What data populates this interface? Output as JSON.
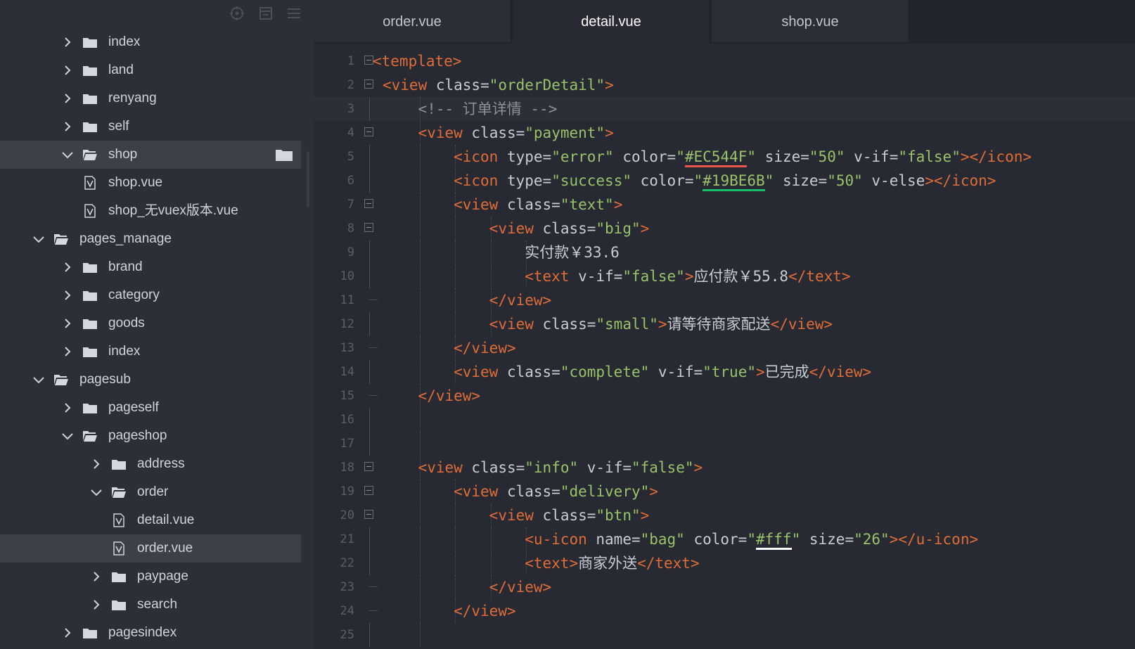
{
  "sidebar": {
    "toolbar": [
      "target-icon",
      "collapse-icon",
      "menu-icon"
    ],
    "rows": [
      {
        "label": "index",
        "level": 2,
        "type": "folder",
        "expanded": false
      },
      {
        "label": "land",
        "level": 2,
        "type": "folder",
        "expanded": false
      },
      {
        "label": "renyang",
        "level": 2,
        "type": "folder",
        "expanded": false
      },
      {
        "label": "self",
        "level": 2,
        "type": "folder",
        "expanded": false
      },
      {
        "label": "shop",
        "level": 2,
        "type": "folder",
        "expanded": true,
        "selected": true,
        "trailing_icon": "folder-icon"
      },
      {
        "label": "shop.vue",
        "level": 3,
        "type": "file"
      },
      {
        "label": "shop_无vuex版本.vue",
        "level": 3,
        "type": "file"
      },
      {
        "label": "pages_manage",
        "level": 1,
        "type": "folder",
        "expanded": true
      },
      {
        "label": "brand",
        "level": 2,
        "type": "folder",
        "expanded": false
      },
      {
        "label": "category",
        "level": 2,
        "type": "folder",
        "expanded": false
      },
      {
        "label": "goods",
        "level": 2,
        "type": "folder",
        "expanded": false
      },
      {
        "label": "index",
        "level": 2,
        "type": "folder",
        "expanded": false
      },
      {
        "label": "pagesub",
        "level": 1,
        "type": "folder",
        "expanded": true
      },
      {
        "label": "pageself",
        "level": 2,
        "type": "folder",
        "expanded": false
      },
      {
        "label": "pageshop",
        "level": 2,
        "type": "folder",
        "expanded": true
      },
      {
        "label": "address",
        "level": 3,
        "type": "folder",
        "expanded": false
      },
      {
        "label": "order",
        "level": 3,
        "type": "folder",
        "expanded": true
      },
      {
        "label": "detail.vue",
        "level": 4,
        "type": "file"
      },
      {
        "label": "order.vue",
        "level": 4,
        "type": "file",
        "selected": true
      },
      {
        "label": "paypage",
        "level": 3,
        "type": "folder",
        "expanded": false
      },
      {
        "label": "search",
        "level": 3,
        "type": "folder",
        "expanded": false
      },
      {
        "label": "pagesindex",
        "level": 2,
        "type": "folder",
        "expanded": false
      }
    ]
  },
  "tabs": [
    {
      "label": "order.vue",
      "active": false
    },
    {
      "label": "detail.vue",
      "active": true
    },
    {
      "label": "shop.vue",
      "active": false
    }
  ],
  "code": {
    "current_line": 3,
    "lines": [
      {
        "n": "1",
        "indent": 0,
        "fold": "open",
        "tokens": [
          [
            "tg",
            "<template>"
          ]
        ]
      },
      {
        "n": "2",
        "indent": 1,
        "fold": "open",
        "tokens": [
          [
            "tg",
            "<view "
          ],
          [
            "at",
            "class="
          ],
          [
            "st",
            "\"orderDetail\""
          ],
          [
            "tg",
            ">"
          ]
        ]
      },
      {
        "n": "3",
        "indent": 2,
        "fold": "line",
        "tokens": [
          [
            "cm",
            "<!-- 订单详情 -->"
          ]
        ]
      },
      {
        "n": "4",
        "indent": 2,
        "fold": "open",
        "tokens": [
          [
            "tg",
            "<view "
          ],
          [
            "at",
            "class="
          ],
          [
            "st",
            "\"payment\""
          ],
          [
            "tg",
            ">"
          ]
        ]
      },
      {
        "n": "5",
        "indent": 3,
        "fold": "line",
        "tokens": [
          [
            "tg",
            "<icon "
          ],
          [
            "at",
            "type="
          ],
          [
            "st",
            "\"error\""
          ],
          [
            "at",
            " color="
          ],
          [
            "st",
            "\""
          ],
          [
            "st u-red",
            "#EC544F"
          ],
          [
            "st",
            "\""
          ],
          [
            "at",
            " size="
          ],
          [
            "st",
            "\"50\""
          ],
          [
            "at",
            " v-if="
          ],
          [
            "st",
            "\"false\""
          ],
          [
            "tg",
            "></icon>"
          ]
        ]
      },
      {
        "n": "6",
        "indent": 3,
        "fold": "line",
        "tokens": [
          [
            "tg",
            "<icon "
          ],
          [
            "at",
            "type="
          ],
          [
            "st",
            "\"success\""
          ],
          [
            "at",
            " color="
          ],
          [
            "st",
            "\""
          ],
          [
            "st u-green",
            "#19BE6B"
          ],
          [
            "st",
            "\""
          ],
          [
            "at",
            " size="
          ],
          [
            "st",
            "\"50\""
          ],
          [
            "at",
            " v-else"
          ],
          [
            "tg",
            "></icon>"
          ]
        ]
      },
      {
        "n": "7",
        "indent": 3,
        "fold": "open",
        "tokens": [
          [
            "tg",
            "<view "
          ],
          [
            "at",
            "class="
          ],
          [
            "st",
            "\"text\""
          ],
          [
            "tg",
            ">"
          ]
        ]
      },
      {
        "n": "8",
        "indent": 4,
        "fold": "open",
        "tokens": [
          [
            "tg",
            "<view "
          ],
          [
            "at",
            "class="
          ],
          [
            "st",
            "\"big\""
          ],
          [
            "tg",
            ">"
          ]
        ]
      },
      {
        "n": "9",
        "indent": 5,
        "fold": "line",
        "tokens": [
          [
            "at",
            "实付款￥33.6"
          ]
        ]
      },
      {
        "n": "10",
        "indent": 5,
        "fold": "line",
        "tokens": [
          [
            "tg",
            "<text "
          ],
          [
            "at",
            "v-if="
          ],
          [
            "st",
            "\"false\""
          ],
          [
            "tg",
            ">"
          ],
          [
            "at",
            "应付款￥55.8"
          ],
          [
            "tg",
            "</text>"
          ]
        ]
      },
      {
        "n": "11",
        "indent": 4,
        "fold": "end",
        "tokens": [
          [
            "tg",
            "</view>"
          ]
        ]
      },
      {
        "n": "12",
        "indent": 4,
        "fold": "line",
        "tokens": [
          [
            "tg",
            "<view "
          ],
          [
            "at",
            "class="
          ],
          [
            "st",
            "\"small\""
          ],
          [
            "tg",
            ">"
          ],
          [
            "at",
            "请等待商家配送"
          ],
          [
            "tg",
            "</view>"
          ]
        ]
      },
      {
        "n": "13",
        "indent": 3,
        "fold": "end",
        "tokens": [
          [
            "tg",
            "</view>"
          ]
        ]
      },
      {
        "n": "14",
        "indent": 3,
        "fold": "line",
        "tokens": [
          [
            "tg",
            "<view "
          ],
          [
            "at",
            "class="
          ],
          [
            "st",
            "\"complete\""
          ],
          [
            "at",
            " v-if="
          ],
          [
            "st",
            "\"true\""
          ],
          [
            "tg",
            ">"
          ],
          [
            "at",
            "已完成"
          ],
          [
            "tg",
            "</view>"
          ]
        ]
      },
      {
        "n": "15",
        "indent": 2,
        "fold": "end",
        "tokens": [
          [
            "tg",
            "</view>"
          ]
        ]
      },
      {
        "n": "16",
        "indent": 2,
        "fold": "line",
        "tokens": []
      },
      {
        "n": "17",
        "indent": 2,
        "fold": "line",
        "tokens": []
      },
      {
        "n": "18",
        "indent": 2,
        "fold": "open",
        "tokens": [
          [
            "tg",
            "<view "
          ],
          [
            "at",
            "class="
          ],
          [
            "st",
            "\"info\""
          ],
          [
            "at",
            " v-if="
          ],
          [
            "st",
            "\"false\""
          ],
          [
            "tg",
            ">"
          ]
        ]
      },
      {
        "n": "19",
        "indent": 3,
        "fold": "open",
        "tokens": [
          [
            "tg",
            "<view "
          ],
          [
            "at",
            "class="
          ],
          [
            "st",
            "\"delivery\""
          ],
          [
            "tg",
            ">"
          ]
        ]
      },
      {
        "n": "20",
        "indent": 4,
        "fold": "open",
        "tokens": [
          [
            "tg",
            "<view "
          ],
          [
            "at",
            "class="
          ],
          [
            "st",
            "\"btn\""
          ],
          [
            "tg",
            ">"
          ]
        ]
      },
      {
        "n": "21",
        "indent": 5,
        "fold": "line",
        "tokens": [
          [
            "tg",
            "<u-icon "
          ],
          [
            "at",
            "name="
          ],
          [
            "st",
            "\"bag\""
          ],
          [
            "at",
            " color="
          ],
          [
            "st",
            "\""
          ],
          [
            "st u-white",
            "#fff"
          ],
          [
            "st",
            "\""
          ],
          [
            "at",
            " size="
          ],
          [
            "st",
            "\"26\""
          ],
          [
            "tg",
            "></u-icon>"
          ]
        ]
      },
      {
        "n": "22",
        "indent": 5,
        "fold": "line",
        "tokens": [
          [
            "tg",
            "<text>"
          ],
          [
            "at",
            "商家外送"
          ],
          [
            "tg",
            "</text>"
          ]
        ]
      },
      {
        "n": "23",
        "indent": 4,
        "fold": "end",
        "tokens": [
          [
            "tg",
            "</view>"
          ]
        ]
      },
      {
        "n": "24",
        "indent": 3,
        "fold": "end",
        "tokens": [
          [
            "tg",
            "</view>"
          ]
        ]
      },
      {
        "n": "25",
        "indent": 2,
        "fold": "line",
        "tokens": []
      }
    ]
  },
  "colors": {
    "background": "#272a32",
    "sidebar": "#2c2f37",
    "tag": "#e06c36",
    "string": "#98c369",
    "comment": "#8c909a",
    "swatch_red": "#EC544F",
    "swatch_green": "#19BE6B",
    "swatch_white": "#ffffff"
  }
}
